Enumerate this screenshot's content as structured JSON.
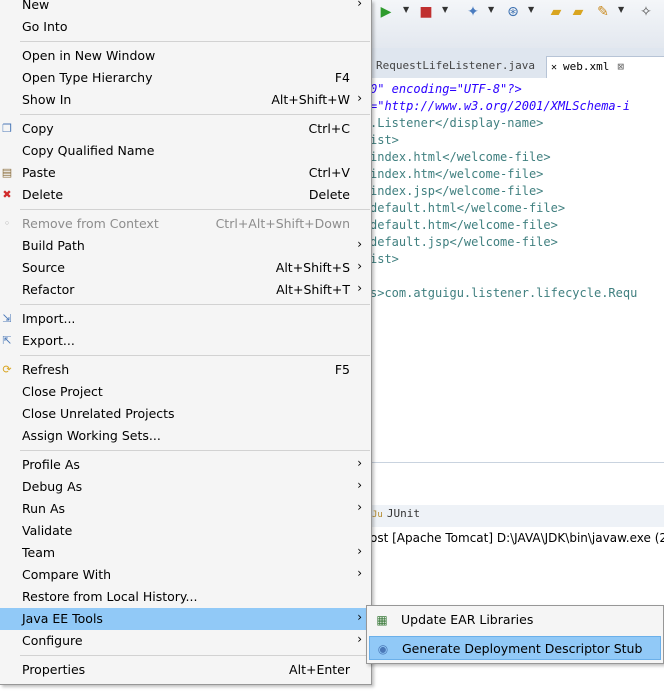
{
  "editor": {
    "tabs": [
      {
        "label": "RequestLifeListener.java"
      },
      {
        "label": "web.xml"
      }
    ],
    "code_lines": [
      "0\" encoding=\"UTF-8\"?>",
      "=\"http://www.w3.org/2001/XMLSchema-i",
      ".Listener</display-name>",
      "ist>",
      "index.html</welcome-file>",
      "index.htm</welcome-file>",
      "index.jsp</welcome-file>",
      "default.html</welcome-file>",
      "default.htm</welcome-file>",
      "default.jsp</welcome-file>",
      "ist>",
      "s>com.atguigu.listener.lifecycle.Requ"
    ]
  },
  "panel": {
    "junit_label": "JUnit",
    "console_text": "ost [Apache Tomcat] D:\\JAVA\\JDK\\bin\\javaw.exe (2"
  },
  "menu": {
    "items": [
      {
        "label": "New",
        "shortcut": "",
        "submenu": true
      },
      {
        "label": "Go Into",
        "shortcut": "",
        "submenu": false
      },
      {
        "label": "Open in New Window",
        "shortcut": "",
        "submenu": false
      },
      {
        "label": "Open Type Hierarchy",
        "shortcut": "F4",
        "submenu": false
      },
      {
        "label": "Show In",
        "shortcut": "Alt+Shift+W",
        "submenu": true
      },
      {
        "label": "Copy",
        "shortcut": "Ctrl+C",
        "submenu": false
      },
      {
        "label": "Copy Qualified Name",
        "shortcut": "",
        "submenu": false
      },
      {
        "label": "Paste",
        "shortcut": "Ctrl+V",
        "submenu": false
      },
      {
        "label": "Delete",
        "shortcut": "Delete",
        "submenu": false
      },
      {
        "label": "Remove from Context",
        "shortcut": "Ctrl+Alt+Shift+Down",
        "submenu": false,
        "disabled": true
      },
      {
        "label": "Build Path",
        "shortcut": "",
        "submenu": true
      },
      {
        "label": "Source",
        "shortcut": "Alt+Shift+S",
        "submenu": true
      },
      {
        "label": "Refactor",
        "shortcut": "Alt+Shift+T",
        "submenu": true
      },
      {
        "label": "Import...",
        "shortcut": "",
        "submenu": false
      },
      {
        "label": "Export...",
        "shortcut": "",
        "submenu": false
      },
      {
        "label": "Refresh",
        "shortcut": "F5",
        "submenu": false
      },
      {
        "label": "Close Project",
        "shortcut": "",
        "submenu": false
      },
      {
        "label": "Close Unrelated Projects",
        "shortcut": "",
        "submenu": false
      },
      {
        "label": "Assign Working Sets...",
        "shortcut": "",
        "submenu": false
      },
      {
        "label": "Profile As",
        "shortcut": "",
        "submenu": true
      },
      {
        "label": "Debug As",
        "shortcut": "",
        "submenu": true
      },
      {
        "label": "Run As",
        "shortcut": "",
        "submenu": true
      },
      {
        "label": "Validate",
        "shortcut": "",
        "submenu": false
      },
      {
        "label": "Team",
        "shortcut": "",
        "submenu": true
      },
      {
        "label": "Compare With",
        "shortcut": "",
        "submenu": true
      },
      {
        "label": "Restore from Local History...",
        "shortcut": "",
        "submenu": false
      },
      {
        "label": "Java EE Tools",
        "shortcut": "",
        "submenu": true,
        "selected": true
      },
      {
        "label": "Configure",
        "shortcut": "",
        "submenu": true
      },
      {
        "label": "Properties",
        "shortcut": "Alt+Enter",
        "submenu": false
      }
    ],
    "arrow_glyph": "›"
  },
  "submenu": {
    "items": [
      {
        "label": "Update EAR Libraries"
      },
      {
        "label": "Generate Deployment Descriptor Stub",
        "selected": true
      }
    ]
  },
  "colors": {
    "menu_bg": "#f5f5f5",
    "selection": "#91c9f7",
    "xml_keyword": "#7f007f",
    "xml_string": "#2a00ff",
    "xml_tag": "#3f7f7f"
  }
}
